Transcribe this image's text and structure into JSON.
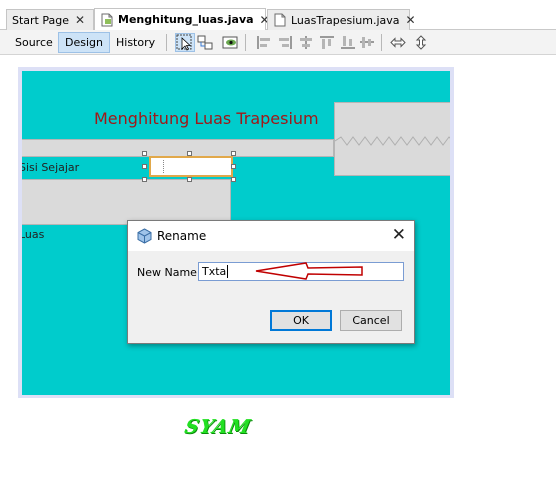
{
  "tabs": [
    {
      "label": "Start Page",
      "active": false
    },
    {
      "label": "Menghitung_luas.java",
      "active": true
    },
    {
      "label": "LuasTrapesium.java",
      "active": false
    }
  ],
  "toolbar": {
    "source_label": "Source",
    "design_label": "Design",
    "history_label": "History",
    "icons": [
      "selection-mode-icon",
      "connection-mode-icon",
      "preview-design-icon",
      "align-left-icon",
      "align-right-icon",
      "center-horizontal-icon",
      "align-top-icon",
      "align-bottom-icon",
      "center-vertical-icon",
      "change-horizontal-resizability-icon",
      "change-vertical-resizability-icon"
    ]
  },
  "form": {
    "title": "Menghitung Luas Trapesium",
    "label_sisi": "Sisi Sejajar",
    "label_luas": "Luas",
    "background": "#00cccc",
    "title_color": "#a01818"
  },
  "dialog": {
    "title": "Rename",
    "field_label": "New Name:",
    "field_value": "Txta",
    "ok_label": "OK",
    "cancel_label": "Cancel"
  },
  "signature": "SYAM",
  "colors": {
    "selection_border": "#e1a84a",
    "annotation_arrow": "#c00000",
    "signature": "#22e022",
    "active_toolbar": "#cde3f7"
  }
}
